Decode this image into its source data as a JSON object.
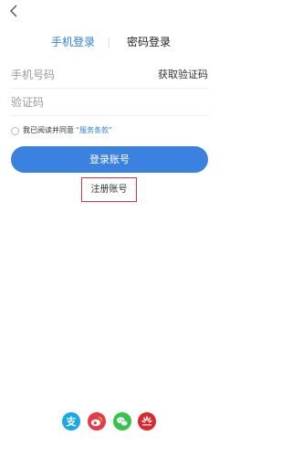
{
  "nav": {
    "back_icon": "chevron-left-icon"
  },
  "tabs": [
    {
      "label": "手机登录",
      "active": true
    },
    {
      "label": "密码登录",
      "active": false
    }
  ],
  "form": {
    "phone_placeholder": "手机号码",
    "get_code_label": "获取验证码",
    "code_placeholder": "验证码"
  },
  "agreement": {
    "text": "我已阅读并同意",
    "link": "“服务条款”"
  },
  "login_button": "登录账号",
  "register_button": "注册账号",
  "social_login": [
    {
      "name": "alipay",
      "icon": "alipay-icon",
      "color": "#1ba8e8"
    },
    {
      "name": "weibo",
      "icon": "weibo-icon",
      "color": "#e6394a"
    },
    {
      "name": "wechat",
      "icon": "wechat-icon",
      "color": "#36c24b"
    },
    {
      "name": "huawei",
      "icon": "huawei-icon",
      "color": "#d9282f"
    }
  ],
  "colors": {
    "accent": "#3b82e0",
    "register_border": "#d83a3a"
  }
}
